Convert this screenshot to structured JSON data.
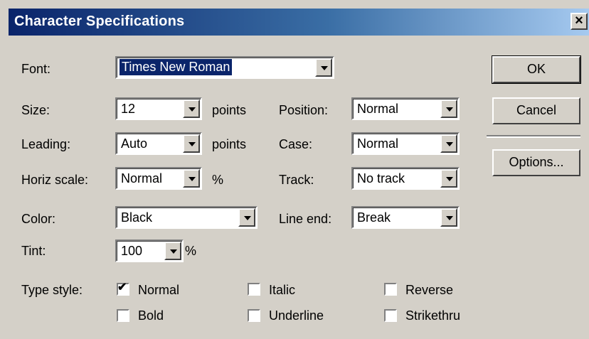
{
  "window": {
    "title": "Character Specifications",
    "close_glyph": "×"
  },
  "fields": {
    "font": {
      "label": "Font:",
      "value": "Times New Roman"
    },
    "size": {
      "label": "Size:",
      "value": "12",
      "unit": "points"
    },
    "leading": {
      "label": "Leading:",
      "value": "Auto",
      "unit": "points"
    },
    "horiz_scale": {
      "label": "Horiz scale:",
      "value": "Normal",
      "unit": "%"
    },
    "color": {
      "label": "Color:",
      "value": "Black"
    },
    "tint": {
      "label": "Tint:",
      "value": "100",
      "unit": "%"
    },
    "position": {
      "label": "Position:",
      "value": "Normal"
    },
    "case": {
      "label": "Case:",
      "value": "Normal"
    },
    "track": {
      "label": "Track:",
      "value": "No track"
    },
    "line_end": {
      "label": "Line end:",
      "value": "Break"
    }
  },
  "type_style": {
    "label": "Type style:",
    "options": [
      {
        "label": "Normal",
        "checked": true
      },
      {
        "label": "Italic",
        "checked": false
      },
      {
        "label": "Reverse",
        "checked": false
      },
      {
        "label": "Bold",
        "checked": false
      },
      {
        "label": "Underline",
        "checked": false
      },
      {
        "label": "Strikethru",
        "checked": false
      }
    ]
  },
  "buttons": {
    "ok": "OK",
    "cancel": "Cancel",
    "options": "Options..."
  },
  "icons": {
    "dropdown": "chevron-down-icon",
    "check": "checkmark-icon",
    "close": "close-icon"
  },
  "colors": {
    "face": "#d4d0c8",
    "title_start": "#0a246a",
    "title_end": "#a6caf0",
    "selection": "#0a246a"
  }
}
